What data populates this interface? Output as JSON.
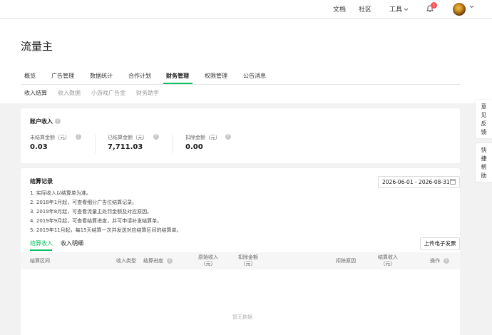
{
  "topbar": {
    "docs": "文档",
    "community": "社区",
    "tools": "工具",
    "bell_count": "1",
    "icons": {
      "bell": "bell-icon",
      "chevron": "chevron-down-icon",
      "avatar": "avatar"
    }
  },
  "page_title": "流量主",
  "tabs": [
    {
      "label": "概览"
    },
    {
      "label": "广告管理"
    },
    {
      "label": "数据统计"
    },
    {
      "label": "合作计划"
    },
    {
      "label": "财务管理",
      "active": true
    },
    {
      "label": "权限管理"
    },
    {
      "label": "公告消息"
    }
  ],
  "subtabs": [
    {
      "label": "收入结算",
      "active": true
    },
    {
      "label": "收入数据"
    },
    {
      "label": "小游戏广告金"
    },
    {
      "label": "财务助手"
    }
  ],
  "account": {
    "title": "账户收入",
    "stats": [
      {
        "label": "未结算金额（元）",
        "value": "0.03"
      },
      {
        "label": "已结算金额（元）",
        "value": "7,711.03"
      },
      {
        "label": "扣除金额（元）",
        "value": "0.00"
      }
    ]
  },
  "records": {
    "title": "结算记录",
    "date_range": "2026-06-01 - 2026-08-31",
    "notes": [
      "1. 实际收入以结算单为准。",
      "2. 2018年1月起，可查看细分广告位结算记录。",
      "3. 2019年8月起，可查看流量主处罚金额及对应原因。",
      "4. 2019年9月起，可查看结算进度，并可申请补发结算单。",
      "5. 2019年11月起，每15天结算一次并发送对应结算区间的结算单。"
    ],
    "inner_tabs": [
      {
        "label": "结算收入",
        "active": true
      },
      {
        "label": "收入明细"
      }
    ],
    "upload_button": "上传电子发票",
    "columns": {
      "period": "结算区间",
      "type": "收入类型",
      "progress": "结算进度",
      "original_1": "原始收入",
      "original_2": "（元）",
      "deduct_1": "扣除金额",
      "deduct_2": "（元）",
      "reason": "扣除原因",
      "settle_1": "结算收入",
      "settle_2": "（元）",
      "action": "操作"
    },
    "empty_text": "暂无数据"
  },
  "side": {
    "feedback": [
      "意",
      "见",
      "反",
      "馈"
    ],
    "help": [
      "快",
      "捷",
      "帮",
      "助"
    ]
  },
  "colors": {
    "accent": "#07c160",
    "badge": "#fa5151"
  }
}
